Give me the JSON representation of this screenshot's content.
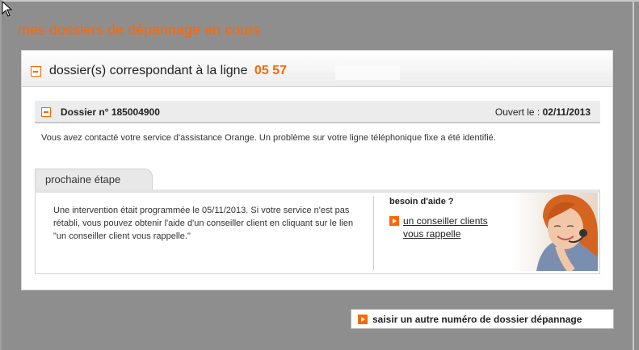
{
  "page": {
    "title": "mes dossiers de dépannage en cours"
  },
  "header": {
    "label": "dossier(s) correspondant à la ligne",
    "line_number": "05 57"
  },
  "dossier": {
    "number_label": "Dossier n° 185004900",
    "opened_label": "Ouvert le :",
    "opened_date": "02/11/2013",
    "description": "Vous avez contacté votre service d'assistance Orange. Un problème sur votre ligne téléphonique fixe a été identifié."
  },
  "next_step": {
    "tab_label": "prochaine étape",
    "text": "Une intervention était programmée le 05/11/2013. Si votre service n'est pas rétabli, vous pouvez obtenir l'aide d'un conseiller client en cliquant sur le lien \"un conseiller client vous rappelle.\""
  },
  "help": {
    "title": "besoin d'aide ?",
    "link_label": "un conseiller clients vous rappelle"
  },
  "actions": {
    "other_number_label": "saisir un autre numéro de dossier dépannage"
  },
  "colors": {
    "accent": "#ff6600",
    "background": "#8e8e8e"
  },
  "icons": [
    "cursor-icon",
    "collapse-icon",
    "arrow-right-icon"
  ]
}
